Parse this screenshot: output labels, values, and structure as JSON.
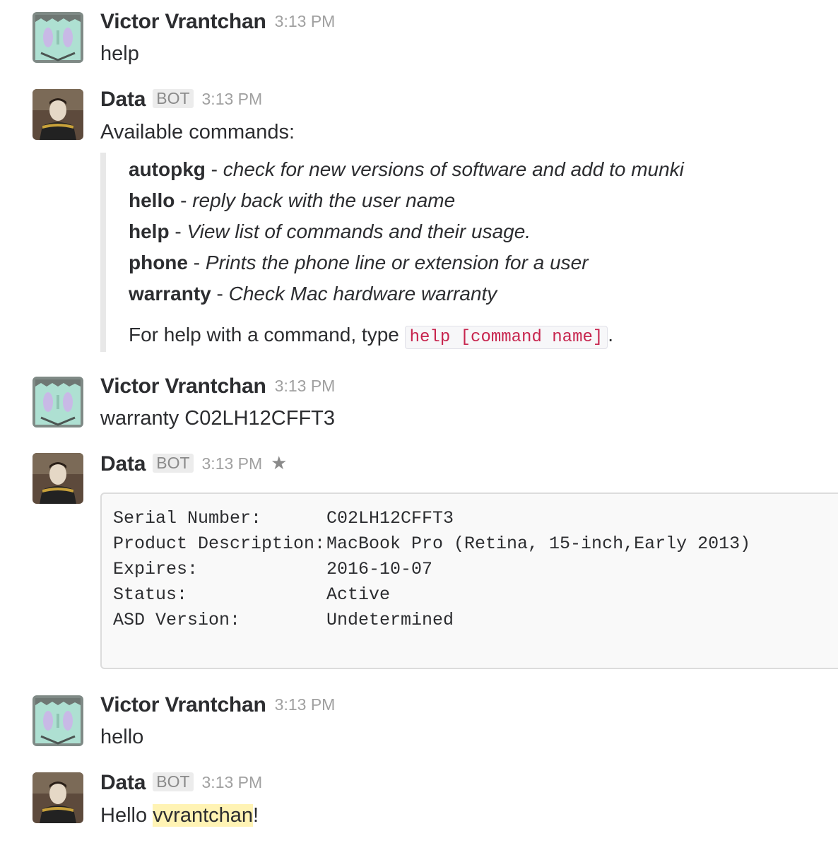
{
  "users": {
    "victor": {
      "name": "Victor Vrantchan"
    },
    "data": {
      "name": "Data",
      "badge": "BOT"
    }
  },
  "messages": [
    {
      "time": "3:13 PM",
      "text": "help"
    },
    {
      "time": "3:13 PM",
      "text": "Available commands:",
      "commands": [
        {
          "name": "autopkg",
          "sep": " - ",
          "desc": "check for new versions of software and add to munki"
        },
        {
          "name": "hello",
          "sep": " - ",
          "desc": "reply back with the user name"
        },
        {
          "name": "help",
          "sep": " - ",
          "desc": "View list of commands and their usage."
        },
        {
          "name": "phone",
          "sep": " - ",
          "desc": "Prints the phone line or extension for a user"
        },
        {
          "name": "warranty",
          "sep": " - ",
          "desc": "Check Mac hardware warranty"
        }
      ],
      "footer_prefix": "For help with a command, type ",
      "footer_code": "help [command name]",
      "footer_suffix": "."
    },
    {
      "time": "3:13 PM",
      "text": "warranty C02LH12CFFT3"
    },
    {
      "time": "3:13 PM",
      "star_icon": "star-icon",
      "warranty": [
        {
          "key": "Serial Number:",
          "value": "C02LH12CFFT3"
        },
        {
          "key": "Product Description:",
          "value": "MacBook Pro (Retina, 15-inch,Early 2013)"
        },
        {
          "key": "Expires:",
          "value": "2016-10-07"
        },
        {
          "key": "Status:",
          "value": "Active"
        },
        {
          "key": "ASD Version:",
          "value": "Undetermined"
        }
      ]
    },
    {
      "time": "3:13 PM",
      "text": "hello"
    },
    {
      "time": "3:13 PM",
      "text_prefix": "Hello ",
      "mention": "vvrantchan",
      "text_suffix": "!"
    }
  ],
  "colors": {
    "mention_bg": "#fff3b4",
    "code_text": "#c7254e"
  }
}
